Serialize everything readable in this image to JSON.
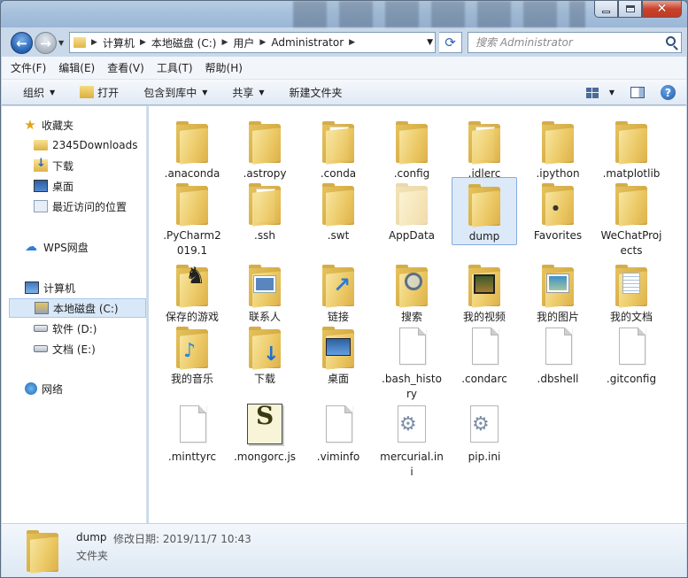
{
  "address": {
    "crumbs": [
      "计算机",
      "本地磁盘 (C:)",
      "用户",
      "Administrator"
    ],
    "search_placeholder": "搜索 Administrator"
  },
  "menu": [
    "文件(F)",
    "编辑(E)",
    "查看(V)",
    "工具(T)",
    "帮助(H)"
  ],
  "toolbar": {
    "organize": "组织",
    "open": "打开",
    "include_library": "包含到库中",
    "share": "共享",
    "new_folder": "新建文件夹"
  },
  "nav": {
    "favorites": "收藏夹",
    "fav_items": [
      "2345Downloads",
      "下载",
      "桌面",
      "最近访问的位置"
    ],
    "wps": "WPS网盘",
    "computer": "计算机",
    "drives": [
      "本地磁盘 (C:)",
      "软件 (D:)",
      "文档 (E:)"
    ],
    "network": "网络"
  },
  "items": [
    {
      "label": ".anaconda",
      "kind": "folder"
    },
    {
      "label": ".astropy",
      "kind": "folder"
    },
    {
      "label": ".conda",
      "kind": "folder-paper"
    },
    {
      "label": ".config",
      "kind": "folder"
    },
    {
      "label": ".idlerc",
      "kind": "folder-paper"
    },
    {
      "label": ".ipython",
      "kind": "folder"
    },
    {
      "label": ".matplotlib",
      "kind": "folder"
    },
    {
      "label": ".PyCharm2019.1",
      "kind": "folder"
    },
    {
      "label": ".ssh",
      "kind": "folder-paper"
    },
    {
      "label": ".swt",
      "kind": "folder"
    },
    {
      "label": "AppData",
      "kind": "folder-faded"
    },
    {
      "label": "dump",
      "kind": "folder",
      "selected": true
    },
    {
      "label": "Favorites",
      "kind": "folder-fav"
    },
    {
      "label": "WeChatProjects",
      "kind": "folder"
    },
    {
      "label": "保存的游戏",
      "kind": "folder-chess"
    },
    {
      "label": "联系人",
      "kind": "folder-card"
    },
    {
      "label": "链接",
      "kind": "folder-link"
    },
    {
      "label": "搜索",
      "kind": "folder-search"
    },
    {
      "label": "我的视频",
      "kind": "folder-video"
    },
    {
      "label": "我的图片",
      "kind": "folder-photo"
    },
    {
      "label": "我的文档",
      "kind": "folder-doc"
    },
    {
      "label": "我的音乐",
      "kind": "folder-music"
    },
    {
      "label": "下载",
      "kind": "folder-dl"
    },
    {
      "label": "桌面",
      "kind": "folder-desk"
    },
    {
      "label": ".bash_history",
      "kind": "file"
    },
    {
      "label": ".condarc",
      "kind": "file"
    },
    {
      "label": ".dbshell",
      "kind": "file"
    },
    {
      "label": ".gitconfig",
      "kind": "file"
    },
    {
      "label": ".minttyrc",
      "kind": "file"
    },
    {
      "label": ".mongorc.js",
      "kind": "script"
    },
    {
      "label": ".viminfo",
      "kind": "file"
    },
    {
      "label": "mercurial.ini",
      "kind": "ini"
    },
    {
      "label": "pip.ini",
      "kind": "ini"
    }
  ],
  "details": {
    "name": "dump",
    "modified_label": "修改日期:",
    "modified_value": "2019/11/7 10:43",
    "type": "文件夹"
  }
}
